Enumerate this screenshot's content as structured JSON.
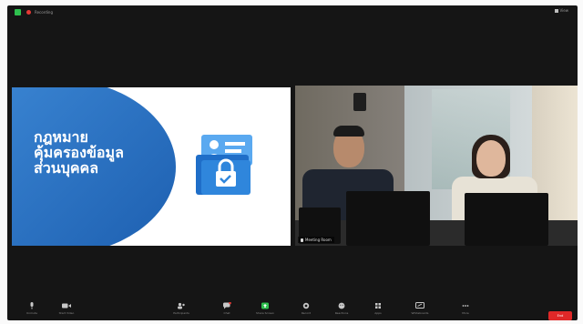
{
  "app": {
    "recording_label": "Recording",
    "view_label": "View"
  },
  "slide": {
    "title_lines": [
      "กฎหมาย",
      "คุ้มครองข้อมูล",
      "ส่วนบุคคล"
    ],
    "accent_color": "#2f7dd1",
    "icon": "id-card-lock-icon"
  },
  "camera_tile": {
    "participant_name": "Meeting Room"
  },
  "toolbar": {
    "items": [
      {
        "label": "Unmute",
        "icon": "microphone-icon"
      },
      {
        "label": "Start Video",
        "icon": "video-camera-icon"
      },
      {
        "label": "Participants",
        "icon": "participants-icon"
      },
      {
        "label": "Chat",
        "icon": "chat-icon"
      },
      {
        "label": "Share Screen",
        "icon": "share-screen-icon"
      },
      {
        "label": "Record",
        "icon": "record-icon"
      },
      {
        "label": "Reactions",
        "icon": "reactions-icon"
      },
      {
        "label": "Apps",
        "icon": "apps-icon"
      },
      {
        "label": "Whiteboards",
        "icon": "whiteboard-icon"
      },
      {
        "label": "More",
        "icon": "more-icon"
      }
    ],
    "end_label": "End"
  },
  "colors": {
    "share_green": "#2ec04e",
    "end_red": "#e02828",
    "record_red": "#e53935"
  }
}
